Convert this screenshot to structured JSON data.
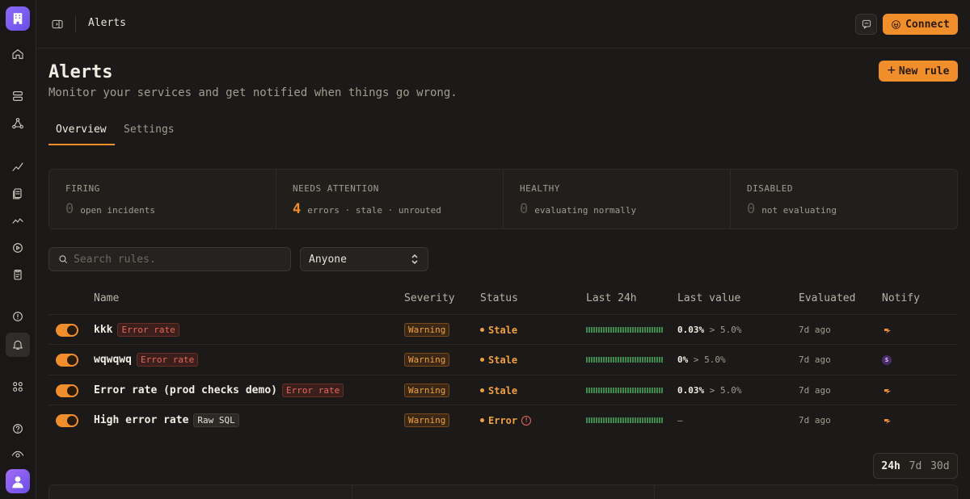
{
  "topbar": {
    "title": "Alerts",
    "connect_label": "Connect"
  },
  "header": {
    "title": "Alerts",
    "subtitle": "Monitor your services and get notified when things go wrong.",
    "new_rule_label": "New rule"
  },
  "tabs": [
    {
      "label": "Overview",
      "active": true
    },
    {
      "label": "Settings",
      "active": false
    }
  ],
  "stats": [
    {
      "label": "FIRING",
      "value": "0",
      "desc": "open incidents"
    },
    {
      "label": "NEEDS ATTENTION",
      "value": "4",
      "desc": "errors · stale · unrouted"
    },
    {
      "label": "HEALTHY",
      "value": "0",
      "desc": "evaluating normally"
    },
    {
      "label": "DISABLED",
      "value": "0",
      "desc": "not evaluating"
    }
  ],
  "filters": {
    "search_placeholder": "Search rules.",
    "owner_selected": "Anyone"
  },
  "table": {
    "headers": {
      "name": "Name",
      "severity": "Severity",
      "status": "Status",
      "last24h": "Last 24h",
      "last_value": "Last value",
      "evaluated": "Evaluated",
      "notify": "Notify"
    },
    "rows": [
      {
        "name": "kkk",
        "tag": "Error rate",
        "severity": "Warning",
        "status": "Stale",
        "value": "0.03%",
        "threshold": "> 5.0%",
        "evaluated": "7d ago",
        "notify": "destination-icon"
      },
      {
        "name": "wqwqwq",
        "tag": "Error rate",
        "severity": "Warning",
        "status": "Stale",
        "value": "0%",
        "threshold": "> 5.0%",
        "evaluated": "7d ago",
        "notify": "S"
      },
      {
        "name": "Error rate (prod checks demo)",
        "tag": "Error rate",
        "severity": "Warning",
        "status": "Stale",
        "value": "0.03%",
        "threshold": "> 5.0%",
        "evaluated": "7d ago",
        "notify": "destination-icon"
      },
      {
        "name": "High error rate",
        "tag": "Raw SQL",
        "severity": "Warning",
        "status": "Error",
        "value": "—",
        "threshold": "",
        "evaluated": "7d ago",
        "notify": "destination-icon"
      }
    ]
  },
  "range": {
    "options": [
      "24h",
      "7d",
      "30d"
    ],
    "selected": "24h"
  },
  "colors": {
    "accent": "#f08e2c",
    "bar_ok": "#3f8a4f",
    "error": "#e8685b"
  }
}
